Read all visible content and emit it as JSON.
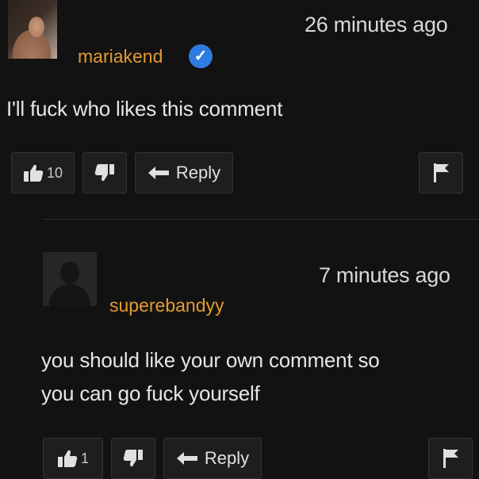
{
  "comments": [
    {
      "username": "mariakend",
      "timestamp": "26 minutes ago",
      "verified": true,
      "text": "I'll fuck who likes this comment",
      "likes": "10",
      "reply_label": "Reply",
      "avatar": "user-photo"
    },
    {
      "username": "superebandyy",
      "timestamp": "7 minutes ago",
      "verified": false,
      "text_lines": [
        "you should like your own comment so",
        "you can go fuck yourself"
      ],
      "likes": "1",
      "reply_label": "Reply",
      "avatar": "default-user-silhouette"
    }
  ],
  "icons": {
    "like": "thumbs-up-icon",
    "dislike": "thumbs-down-icon",
    "reply": "reply-arrow-icon",
    "flag": "flag-icon",
    "verified": "verified-check-icon"
  },
  "colors": {
    "background": "#121212",
    "username": "#e39b2f",
    "verified_badge": "#2f7ce0",
    "text": "#e6e6e6"
  }
}
